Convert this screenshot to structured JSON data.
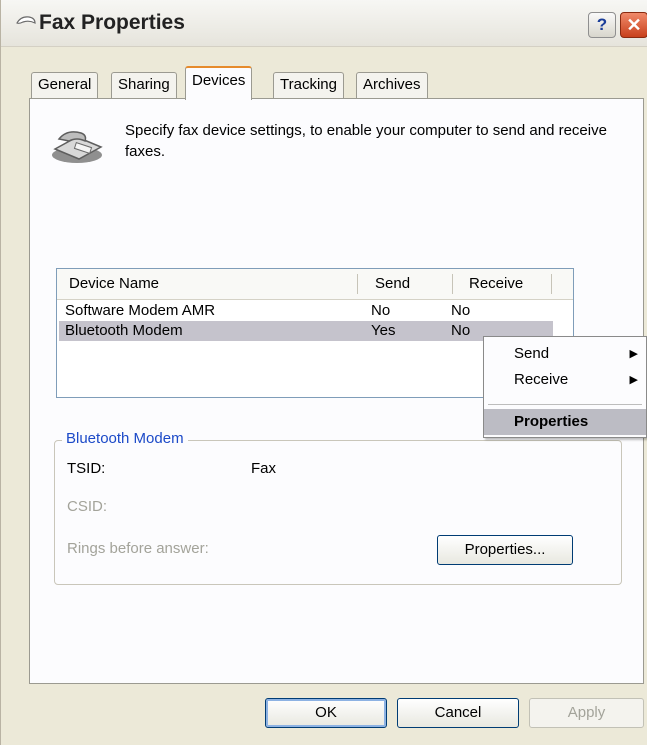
{
  "window": {
    "title": "Fax Properties",
    "help_label": "?",
    "close_label": "✕"
  },
  "tabs": [
    {
      "label": "General"
    },
    {
      "label": "Sharing"
    },
    {
      "label": "Devices"
    },
    {
      "label": "Tracking"
    },
    {
      "label": "Archives"
    }
  ],
  "active_tab": "Devices",
  "description": "Specify fax device settings, to enable your computer to send and receive faxes.",
  "device_list": {
    "columns": [
      "Device Name",
      "Send",
      "Receive"
    ],
    "rows": [
      {
        "name": "Software Modem AMR",
        "send": "No",
        "receive": "No"
      },
      {
        "name": "Bluetooth Modem",
        "send": "Yes",
        "receive": "No"
      }
    ],
    "selected_row": "Bluetooth Modem"
  },
  "context_menu": {
    "items": [
      {
        "label": "Send",
        "arrow": "▶"
      },
      {
        "label": "Receive",
        "arrow": "▶"
      },
      {
        "label": "Properties"
      }
    ]
  },
  "device_group": {
    "title": "Bluetooth Modem",
    "tsid_label": "TSID:",
    "tsid_value": "Fax",
    "csid_label": "CSID:",
    "rings_label": "Rings before answer:",
    "properties_button": "Properties..."
  },
  "buttons": {
    "ok": "OK",
    "cancel": "Cancel",
    "apply": "Apply"
  },
  "colors": {
    "accent": "#1c4ac8",
    "tab_highlight": "#e68b2c",
    "selection": "#c5c3cc"
  }
}
